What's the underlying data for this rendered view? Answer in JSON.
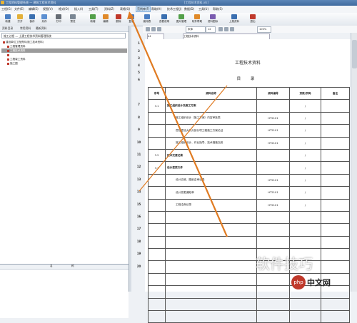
{
  "window": {
    "title": "工程资料管理系统 — 建筑工程技术资料",
    "title_right": "[工程技术资料.xls]"
  },
  "menu": [
    "工程(G)",
    "文件(E)",
    "编辑(E)",
    "视图(V)",
    "格式(O)",
    "插入(I)",
    "工具(T)",
    "资料(Z)",
    "表格(Q)",
    "范例库(F)",
    "帮助(H)",
    "技术工程(J)",
    "数据(D)",
    "工具(U)",
    "帮助(S)"
  ],
  "menu_highlight": "范例库(F)",
  "toolbar": [
    {
      "label": "新建",
      "color": "#4a7ec2"
    },
    {
      "label": "打开",
      "color": "#e3b03a"
    },
    {
      "label": "保存",
      "color": "#3a6fb0"
    },
    {
      "label": "另存",
      "color": "#5b8fd1"
    },
    {
      "label": "打印",
      "color": "#666c75"
    },
    {
      "label": "预览",
      "color": "#7a8794"
    },
    {
      "label": "新增",
      "color": "#53a04a"
    },
    {
      "label": "编辑",
      "color": "#e08a2a"
    },
    {
      "label": "删除",
      "color": "#c0392b"
    },
    {
      "label": "复制",
      "color": "#4a7ec2"
    },
    {
      "label": "套用表",
      "color": "#4a7ec2"
    },
    {
      "label": "查看说明",
      "color": "#3a6fb0"
    },
    {
      "label": "图片管理",
      "color": "#53a04a"
    },
    {
      "label": "软件帮助",
      "color": "#e08a2a"
    },
    {
      "label": "资料图标",
      "color": "#7a5bb0"
    },
    {
      "label": "上报资料",
      "color": "#3a6fb0"
    },
    {
      "label": "退出",
      "color": "#c0392b"
    }
  ],
  "toolbar2": {
    "font": "宋体",
    "size": "12",
    "zoom": "100%"
  },
  "left_panel": {
    "tabs": [
      "资料目录",
      "常用资料",
      "最新资料"
    ],
    "combo": "施工过程 — 土建工程技术资料管理系统",
    "tree": [
      {
        "label": "建设单位工程资料(施工技术资料)",
        "sel": false
      },
      {
        "label": "工程管理资料",
        "sel": false
      },
      {
        "label": "工程技术资料",
        "sel": true
      },
      {
        "label": "",
        "sel": false
      },
      {
        "label": "工程竣工资料",
        "sel": false
      },
      {
        "label": "施工图",
        "sel": false
      }
    ],
    "status_cols": [
      "名",
      "称"
    ]
  },
  "sheet": {
    "cell_ref": "A1",
    "formula": "工程技术资料",
    "title": "工程技术资料",
    "subtitle": "目 录",
    "headers": [
      "序号",
      "资料名称",
      "资料编号",
      "页数/页码",
      "备注"
    ],
    "row_numbers": [
      "1",
      "2",
      "3",
      "4",
      "5",
      "6",
      "7",
      "8",
      "9",
      "10",
      "11",
      "12",
      "13",
      "14",
      "15",
      "16",
      "17",
      "18",
      "19",
      "20"
    ],
    "rows": [
      [
        "3.1",
        "施工组织设计及施工方案",
        "",
        "/",
        ""
      ],
      [
        "",
        "施工组织设计（施工方案）内容审批表",
        "HT2101",
        "/",
        ""
      ],
      [
        "",
        "危险性较大的分部分项工程施工方案论证",
        "HT2101",
        "/",
        ""
      ],
      [
        "",
        "施工组织设计、作业指导、技术措施交底",
        "HT2101",
        "/",
        ""
      ],
      [
        "3.2",
        "技术交底记录",
        "",
        "/",
        ""
      ],
      [
        "3.3",
        "设计变更文件",
        "",
        "/",
        ""
      ],
      [
        "",
        "设计交底、图纸会审记录",
        "HT2101",
        "/",
        ""
      ],
      [
        "",
        "设计变更通知单",
        "HT2101",
        "/",
        ""
      ],
      [
        "",
        "工程洽商记录",
        "HT2101",
        "/",
        ""
      ],
      [
        "",
        "",
        "",
        "",
        ""
      ],
      [
        "",
        "",
        "",
        "",
        ""
      ],
      [
        "",
        "",
        "",
        "",
        ""
      ],
      [
        "",
        "",
        "",
        "",
        ""
      ],
      [
        "",
        "",
        "",
        "",
        ""
      ],
      [
        "",
        "",
        "",
        "",
        ""
      ],
      [
        "",
        "",
        "",
        "",
        ""
      ],
      [
        "",
        "",
        "",
        "",
        ""
      ],
      [
        "",
        "",
        "",
        "",
        ""
      ]
    ]
  },
  "watermark": {
    "text": "软件技巧",
    "logo": "php",
    "brand": "中文网"
  }
}
